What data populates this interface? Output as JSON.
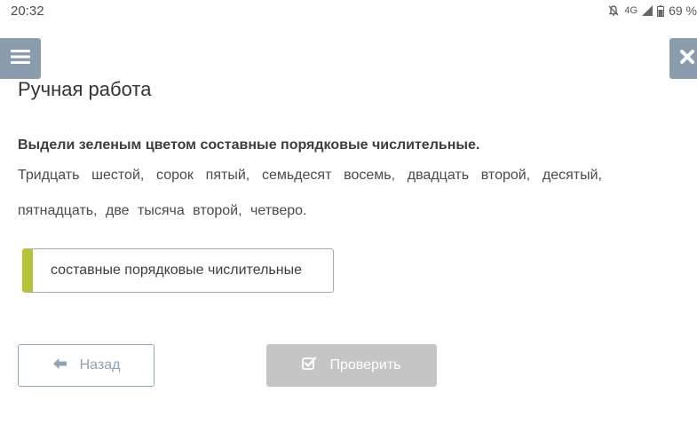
{
  "status": {
    "time": "20:32",
    "network": "4G",
    "battery": "69 %",
    "icons": [
      "mute-icon",
      "signal-icon",
      "battery-icon"
    ]
  },
  "nav": {
    "menu_icon": "hamburger-icon",
    "close_icon": "close-icon",
    "accent_color": "#8b9dad"
  },
  "page": {
    "title": "Ручная работа"
  },
  "task": {
    "instruction": "Выдели зеленым цветом составные порядковые числительные.",
    "text": "Тридцать шестой, сорок пятый, семьдесят восемь, двадцать второй, десятый, пятнадцать, две тысяча второй, четверо."
  },
  "category": {
    "label": "составные порядковые числительные",
    "color": "#b6c23a"
  },
  "buttons": {
    "back_label": "Назад",
    "back_icon": "arrow-left-icon",
    "check_label": "Проверить",
    "check_icon": "checkbox-icon",
    "check_disabled": true
  }
}
